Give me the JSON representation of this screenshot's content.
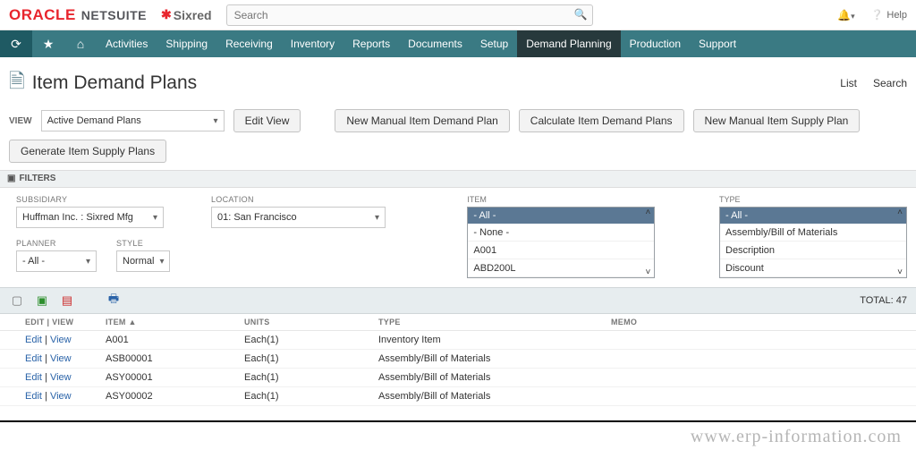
{
  "brand": {
    "oracle": "ORACLE",
    "netsuite": "NETSUITE",
    "sixred": "Sixred"
  },
  "search": {
    "placeholder": "Search"
  },
  "top": {
    "help": "Help"
  },
  "nav": {
    "items": [
      {
        "label": "Activities"
      },
      {
        "label": "Shipping"
      },
      {
        "label": "Receiving"
      },
      {
        "label": "Inventory"
      },
      {
        "label": "Reports"
      },
      {
        "label": "Documents"
      },
      {
        "label": "Setup"
      },
      {
        "label": "Demand Planning",
        "active": true
      },
      {
        "label": "Production"
      },
      {
        "label": "Support"
      }
    ]
  },
  "page": {
    "title": "Item Demand Plans",
    "list": "List",
    "search": "Search"
  },
  "view": {
    "label": "VIEW",
    "value": "Active Demand Plans",
    "edit": "Edit View",
    "btn1": "New Manual Item Demand Plan",
    "btn2": "Calculate Item Demand Plans",
    "btn3": "New Manual Item Supply Plan"
  },
  "gen": {
    "label": "Generate Item Supply Plans"
  },
  "filters": {
    "label": "FILTERS",
    "subsidiary": {
      "label": "SUBSIDIARY",
      "value": "Huffman Inc. : Sixred Mfg"
    },
    "location": {
      "label": "LOCATION",
      "value": "01: San Francisco"
    },
    "planner": {
      "label": "PLANNER",
      "value": "- All -"
    },
    "style": {
      "label": "STYLE",
      "value": "Normal"
    },
    "item": {
      "label": "ITEM",
      "head": "- All -",
      "opts": [
        "- None -",
        "A001",
        "ABD200L"
      ]
    },
    "type": {
      "label": "TYPE",
      "head": "- All -",
      "opts": [
        "Assembly/Bill of Materials",
        "Description",
        "Discount"
      ]
    }
  },
  "tabletb": {
    "total": "TOTAL: 47"
  },
  "table": {
    "headers": {
      "editview": "EDIT | VIEW",
      "item": "ITEM ▲",
      "units": "UNITS",
      "type": "TYPE",
      "memo": "MEMO"
    },
    "rows": [
      {
        "item": "A001",
        "units": "Each(1)",
        "type": "Inventory Item",
        "memo": ""
      },
      {
        "item": "ASB00001",
        "units": "Each(1)",
        "type": "Assembly/Bill of Materials",
        "memo": ""
      },
      {
        "item": "ASY00001",
        "units": "Each(1)",
        "type": "Assembly/Bill of Materials",
        "memo": ""
      },
      {
        "item": "ASY00002",
        "units": "Each(1)",
        "type": "Assembly/Bill of Materials",
        "memo": ""
      }
    ],
    "edit": "Edit",
    "view": "View"
  },
  "watermark": "www.erp-information.com"
}
